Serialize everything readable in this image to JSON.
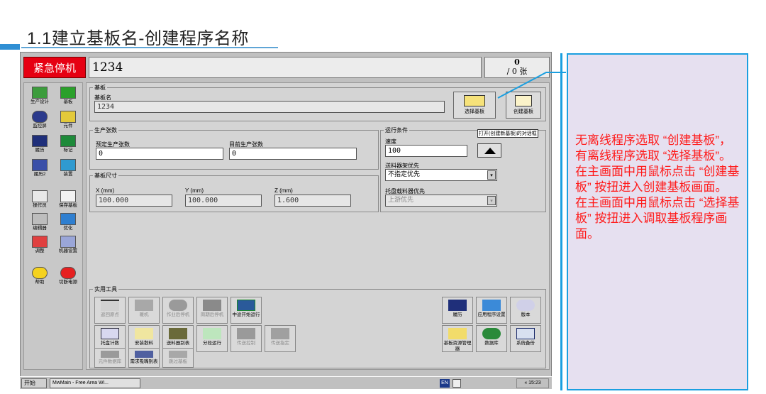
{
  "slide": {
    "title": "1.1建立基板名-创建程序名称",
    "callout_lines": [
      "无离线程序选取 “创建基板”，有离线程序选取 “选择基板”。",
      "在主画面中用鼠标点击 “创建基板” 按扭进入创建基板画面。",
      "在主画面中用鼠标点击 “选择基板” 按扭进入调取基板程序画面。"
    ]
  },
  "app": {
    "estop_label": "紧急停机",
    "program_name": "1234",
    "counter_top": "0",
    "counter_bottom": "/ 0 张",
    "sidebar": [
      {
        "label": "生产设计",
        "icon": "production-design-icon"
      },
      {
        "label": "基板",
        "icon": "board-icon"
      },
      {
        "label": "监控屏",
        "icon": "monitor-icon"
      },
      {
        "label": "元件",
        "icon": "component-icon"
      },
      {
        "label": "履历",
        "icon": "history-icon"
      },
      {
        "label": "标记",
        "icon": "mark-icon"
      },
      {
        "label": "履历2",
        "icon": "history2-icon"
      },
      {
        "label": "装置",
        "icon": "device-icon"
      },
      {
        "label": "操作员",
        "icon": "operator-icon"
      },
      {
        "label": "保存基板",
        "icon": "save-board-icon"
      },
      {
        "label": "编辑器",
        "icon": "editor-icon"
      },
      {
        "label": "优化",
        "icon": "optimize-icon"
      },
      {
        "label": "调整",
        "icon": "adjust-icon"
      },
      {
        "label": "机器设置",
        "icon": "machine-settings-icon"
      },
      {
        "label": "帮助",
        "icon": "help-icon"
      },
      {
        "label": "切断电源",
        "icon": "power-off-icon"
      }
    ],
    "board": {
      "group_label": "基板",
      "name_label": "基板名",
      "name_value": "1234",
      "select_board_label": "选择基板",
      "create_board_label": "创建基板",
      "tooltip": "打开(创建新基板)的对话框"
    },
    "production": {
      "group_label": "生产张数",
      "planned_label": "预定生产张数",
      "planned_value": "0",
      "current_label": "目前生产张数",
      "current_value": "0"
    },
    "board_size": {
      "group_label": "基板尺寸",
      "x_label": "X  (mm)",
      "x_value": "100.000",
      "y_label": "Y  (mm)",
      "y_value": "100.000",
      "z_label": "Z  (mm)",
      "z_value": "1.600"
    },
    "run_conditions": {
      "group_label": "运行条件",
      "speed_label": "速度",
      "speed_value": "100",
      "feeder_label": "送料器架优先",
      "feeder_value": "不指定优先",
      "tray_label": "托盘载料器优先",
      "tray_value": "上游优先"
    },
    "tools": {
      "group_label": "实用工具",
      "items": [
        {
          "label": "返回原点",
          "enabled": false,
          "icon": "home-origin-icon"
        },
        {
          "label": "暖机",
          "enabled": false,
          "icon": "warmup-icon"
        },
        {
          "label": "作业后停机",
          "enabled": false,
          "icon": "stop-after-job-icon"
        },
        {
          "label": "周期后停机",
          "enabled": false,
          "icon": "stop-after-cycle-icon"
        },
        {
          "label": "中途开始运行",
          "enabled": true,
          "icon": "resume-run-icon"
        },
        {
          "label": "托盘计数",
          "enabled": true,
          "icon": "tray-count-icon"
        },
        {
          "label": "安装散料",
          "enabled": true,
          "icon": "loose-parts-icon"
        },
        {
          "label": "送料器别表",
          "enabled": true,
          "icon": "feeder-list-icon"
        },
        {
          "label": "分段运行",
          "enabled": true,
          "icon": "step-run-icon"
        },
        {
          "label": "传送控制",
          "enabled": false,
          "icon": "conveyor-control-icon"
        },
        {
          "label": "传送指定",
          "enabled": false,
          "icon": "conveyor-specify-icon"
        },
        {
          "label": "元件数据库",
          "enabled": false,
          "icon": "parts-db-icon"
        },
        {
          "label": "需求吸嘴别表",
          "enabled": true,
          "icon": "nozzle-list-icon"
        },
        {
          "label": "跳过基板",
          "enabled": false,
          "icon": "skip-board-icon"
        }
      ],
      "right_items": [
        {
          "label": "履历",
          "icon": "history-tool-icon"
        },
        {
          "label": "应用程序设置",
          "icon": "app-settings-icon"
        },
        {
          "label": "版本",
          "icon": "version-icon"
        },
        {
          "label": "基板资源管理器",
          "icon": "board-explorer-icon"
        },
        {
          "label": "数据库",
          "icon": "database-icon"
        },
        {
          "label": "系统备份",
          "icon": "system-backup-icon"
        }
      ]
    },
    "taskbar": {
      "start_label": "开始",
      "task_label": "MwMain - Free Area Wi...",
      "lang": "EN",
      "clock": "« 15:23"
    }
  }
}
